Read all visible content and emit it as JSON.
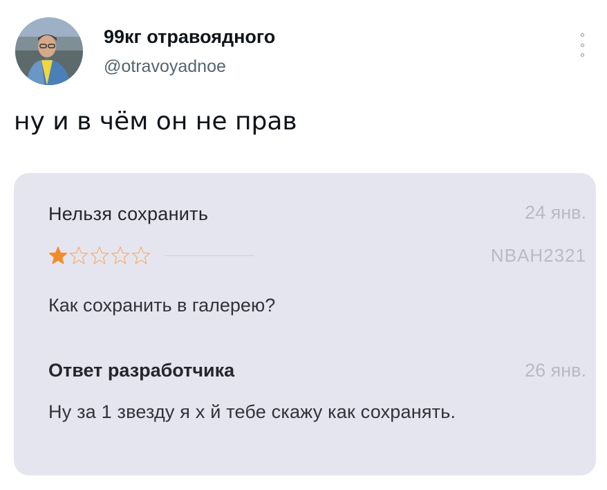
{
  "tweet": {
    "display_name": "99кг отравоядного",
    "handle": "@otravoyadnoe",
    "text": "ну и в чём он не прав",
    "more_icon": "vertical-dots-icon"
  },
  "review": {
    "title": "Нельзя сохранить",
    "date": "24 янв.",
    "rating": 1,
    "rating_max": 5,
    "reviewer": "NBAH2321",
    "body": "Как сохранить в галерею?",
    "star_filled_color": "#f08c2a",
    "star_empty_color": "#f3b07a"
  },
  "developer_reply": {
    "title": "Ответ разработчика",
    "date": "26 янв.",
    "body": "Ну за 1 звезду я х  й тебе скажу как сохранять."
  }
}
